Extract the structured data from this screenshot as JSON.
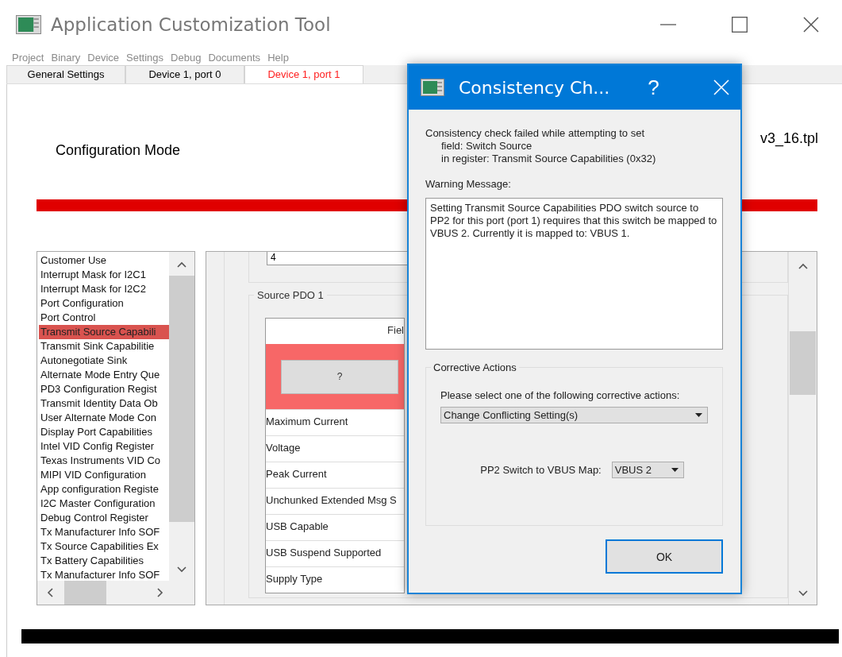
{
  "window": {
    "title": "Application Customization Tool"
  },
  "menu": [
    "Project",
    "Binary",
    "Device",
    "Settings",
    "Debug",
    "Documents",
    "Help"
  ],
  "tabs": [
    {
      "label": "General Settings",
      "selected": false
    },
    {
      "label": "Device 1, port 0",
      "selected": false
    },
    {
      "label": "Device 1, port 1",
      "selected": true
    }
  ],
  "header": {
    "title": "Configuration Mode",
    "file_name": "v3_16.tpl"
  },
  "register_list": {
    "items": [
      {
        "label": "Customer Use",
        "selected": false
      },
      {
        "label": "Interrupt Mask for I2C1",
        "selected": false
      },
      {
        "label": "Interrupt Mask for I2C2",
        "selected": false
      },
      {
        "label": "Port Configuration",
        "selected": false
      },
      {
        "label": "Port Control",
        "selected": false
      },
      {
        "label": "Transmit Source Capabili",
        "selected": true
      },
      {
        "label": "Transmit Sink Capabilitie",
        "selected": false
      },
      {
        "label": "Autonegotiate Sink",
        "selected": false
      },
      {
        "label": "Alternate Mode Entry Que",
        "selected": false
      },
      {
        "label": "PD3 Configuration Regist",
        "selected": false
      },
      {
        "label": "Transmit Identity Data Ob",
        "selected": false
      },
      {
        "label": "User Alternate Mode Con",
        "selected": false
      },
      {
        "label": "Display Port Capabilities",
        "selected": false
      },
      {
        "label": "Intel VID Config Register",
        "selected": false
      },
      {
        "label": "Texas Instruments VID Co",
        "selected": false
      },
      {
        "label": "MIPI VID Configuration",
        "selected": false
      },
      {
        "label": "App configuration Registe",
        "selected": false
      },
      {
        "label": "I2C Master Configuration",
        "selected": false
      },
      {
        "label": "Debug Control Register",
        "selected": false
      },
      {
        "label": "Tx Manufacturer Info SOF",
        "selected": false
      },
      {
        "label": "Tx Source Capabilities Ex",
        "selected": false
      },
      {
        "label": "Tx Battery Capabilities",
        "selected": false
      },
      {
        "label": "Tx Manufacturer Info SOF",
        "selected": false
      }
    ]
  },
  "register_panel": {
    "field_value": "4",
    "group_title": "Source PDO 1",
    "table_header": "Fiel",
    "error_button": "?",
    "rows": [
      "Maximum Current",
      "Voltage",
      "Peak Current",
      "Unchunked Extended Msg S",
      "USB Capable",
      "USB Suspend Supported",
      "Supply Type"
    ]
  },
  "dialog": {
    "title": "Consistency Ch...",
    "help": "?",
    "intro": "Consistency check failed while attempting to set",
    "details": [
      "field: Switch Source",
      "in register: Transmit Source Capabilities (0x32)"
    ],
    "warning_label": "Warning Message:",
    "warning_text": "Setting Transmit Source Capabilities PDO switch source to PP2 for this port (port 1) requires that this switch be mapped to VBUS 2. Currently it is mapped to: VBUS 1.",
    "group_title": "Corrective Actions",
    "prompt": "Please select one of the following corrective actions:",
    "action": "Change Conflicting Setting(s)",
    "map_label": "PP2 Switch to VBUS Map:",
    "map_value": "VBUS 2",
    "ok": "OK"
  }
}
